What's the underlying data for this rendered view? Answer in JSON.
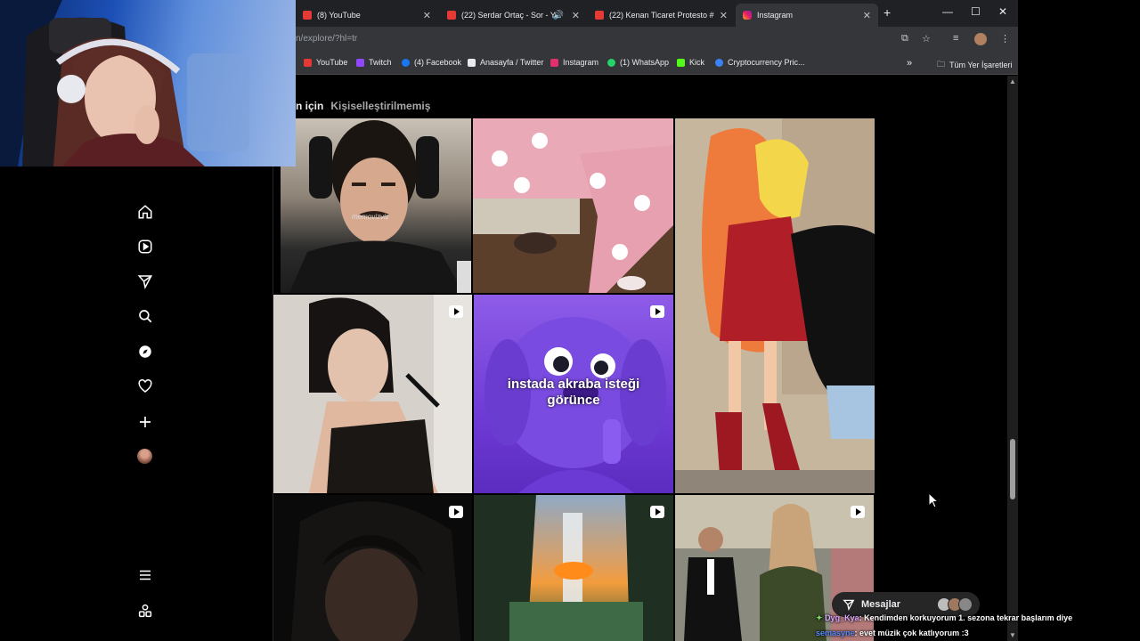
{
  "browser": {
    "tabs": [
      {
        "title": "(8) YouTube",
        "icon": "youtube-icon"
      },
      {
        "title": "(22) Serdar Ortaç - Sor - Yo",
        "icon": "youtube-icon"
      },
      {
        "title": "(22) Kenan Ticaret Protesto #g",
        "icon": "youtube-icon"
      },
      {
        "title": "Instagram",
        "icon": "instagram-icon"
      }
    ],
    "new_tab": "+",
    "url": "n/explore/?hl=tr",
    "bookmarks": [
      {
        "label": "YouTube",
        "color": "#e53935"
      },
      {
        "label": "Twitch",
        "color": "#9146ff"
      },
      {
        "label": "(4) Facebook",
        "color": "#1877f2"
      },
      {
        "label": "Anasayfa / Twitter",
        "color": "#e8eaed"
      },
      {
        "label": "Instagram",
        "color": "#e1306c"
      },
      {
        "label": "(1) WhatsApp",
        "color": "#25d366"
      },
      {
        "label": "Kick",
        "color": "#53fc18"
      },
      {
        "label": "Cryptocurrency Pric...",
        "color": "#3b82f6"
      }
    ],
    "more_bookmarks": "»",
    "all_bookmarks": "Tüm Yer İşaretleri"
  },
  "explore": {
    "tab_for_you": "n için",
    "tab_unpersonalized": "Kişiselleştirilmemiş",
    "watermark": "memovizviz",
    "overlay_caption_line1": "instada akraba isteği",
    "overlay_caption_line2": "görünce"
  },
  "messages": {
    "label": "Mesajlar"
  },
  "chat": [
    {
      "user": "Dyg_Kya",
      "text": ": Kendimden korkuyorum 1. sezona tekrar başlarım diye",
      "user_color": "#d8a6ff"
    },
    {
      "user": "semasyne",
      "text": ": evet müzik çok katlıyorum :3",
      "user_color": "#5b8cff"
    }
  ],
  "colors": {
    "accent": "#0095f6",
    "background": "#000000"
  }
}
